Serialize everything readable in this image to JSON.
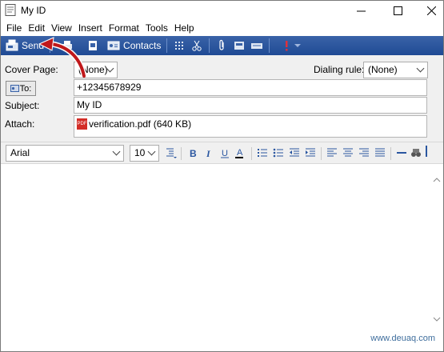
{
  "window": {
    "title": "My ID"
  },
  "menu": [
    "File",
    "Edit",
    "View",
    "Insert",
    "Format",
    "Tools",
    "Help"
  ],
  "toolbar": {
    "send_label": "Send",
    "contacts_label": "Contacts"
  },
  "header": {
    "cover_page_label": "Cover Page:",
    "cover_page_value": "(None)",
    "dialing_rule_label": "Dialing rule:",
    "dialing_rule_value": "(None)",
    "to_button_label": "To:",
    "to_value": "+12345678929",
    "subject_label": "Subject:",
    "subject_value": "My ID",
    "attach_label": "Attach:",
    "attachment": "verification.pdf (640 KB)",
    "attachment_badge": "PDF"
  },
  "format": {
    "font": "Arial",
    "size": "10"
  },
  "colors": {
    "toolbar": "#2a56a0",
    "annotation_arrow": "#c0181b"
  },
  "watermark": "www.deuaq.com"
}
